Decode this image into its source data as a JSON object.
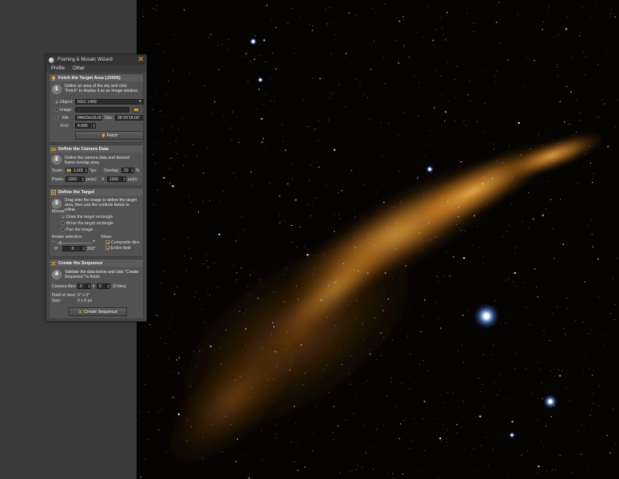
{
  "window": {
    "title": "Framing & Mosaic Wizard",
    "close_icon": "close-icon"
  },
  "menu": {
    "items": [
      "Profile",
      "Other"
    ]
  },
  "sections": {
    "fetch": {
      "header": "Fetch the Target Area (J2000)",
      "step": "1",
      "description": "Define an area of the sky and click \"Fetch\" to display it as an image window.",
      "object_label": "Object:",
      "object_value": "NGC 1499",
      "image_label": "Image:",
      "image_value": "",
      "ra_label": "RA:",
      "ra_value": "04h03m18.00s",
      "dec_label": "Dec:",
      "dec_value": "36°25'18.00\"",
      "fov_label": "FoV:",
      "fov_value": "4.000",
      "fetch_button": "Fetch"
    },
    "camera": {
      "header": "Define the Camera Data",
      "step": "2",
      "description": "Define the camera data and desired frame overlap area.",
      "scale_label": "Scale:",
      "scale_value": "1.000",
      "scale_unit": "\"/px",
      "overlap_label": "Overlap:",
      "overlap_value": "20",
      "overlap_unit": "%",
      "pixels_label": "Pixels:",
      "pixels_w": "1000",
      "pixels_w_unit": "px(w)",
      "x_label": "X",
      "pixels_h": "1000",
      "pixels_h_unit": "px(h)"
    },
    "target": {
      "header": "Define the Target",
      "step": "3",
      "description": "Drag onto the image to define the target area, then use the controls below to refine.",
      "mouse_label": "Mouse:",
      "mouse_options": [
        "Draw the target rectangle",
        "Move the target rectangle",
        "Pan the image"
      ],
      "rotate_label": "Rotate selection:",
      "rotate_min": "0°",
      "rotate_value": "0",
      "rotate_max": "360°",
      "show_label": "Show:",
      "show_options": [
        "Composite tiles",
        "Entire field"
      ]
    },
    "sequence": {
      "header": "Create the Sequence",
      "step": "4",
      "description": "Validate the data below and click \"Create Sequence\" to finish.",
      "tiles_label": "Camera tiles:",
      "tiles_x": "0",
      "tiles_sep": "x",
      "tiles_y": "0",
      "tiles_count": "(0 tiles)",
      "fov_label": "Field of view:",
      "fov_value": "0° x 0°",
      "size_label": "Size:",
      "size_value": "0 x 0 px",
      "create_button": "Create Sequence"
    }
  },
  "colors": {
    "accent": "#e08a1a",
    "panel": "#474747",
    "app_bg": "#3a3a3a",
    "nebula": "#d98a2a"
  },
  "image": {
    "subject": "NGC 1499",
    "description": "California Nebula starfield"
  }
}
